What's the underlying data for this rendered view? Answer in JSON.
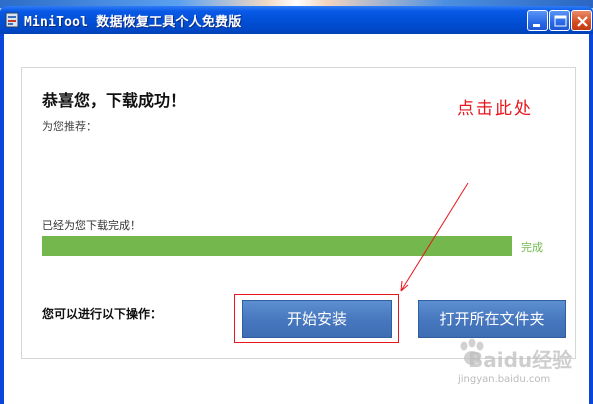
{
  "window": {
    "title": "MiniTool 数据恢复工具个人免费版",
    "controls": {
      "minimize": "minimize-icon",
      "maximize": "maximize-icon",
      "close": "close-icon"
    },
    "icon": "app-icon"
  },
  "main": {
    "heading": "恭喜您，下载成功！",
    "recommend_label": "为您推荐：",
    "download_status": "已经为您下载完成！",
    "progress": {
      "value": 1.0,
      "label": "完成",
      "color": "#74b84d"
    },
    "operations_label": "您可以进行以下操作：",
    "install_button": "开始安装",
    "open_folder_button": "打开所在文件夹"
  },
  "annotation": {
    "text": "点击此处",
    "color": "#e8151b"
  },
  "watermark": {
    "brand": "Baidu经验",
    "url": "jingyan.baidu.com"
  }
}
